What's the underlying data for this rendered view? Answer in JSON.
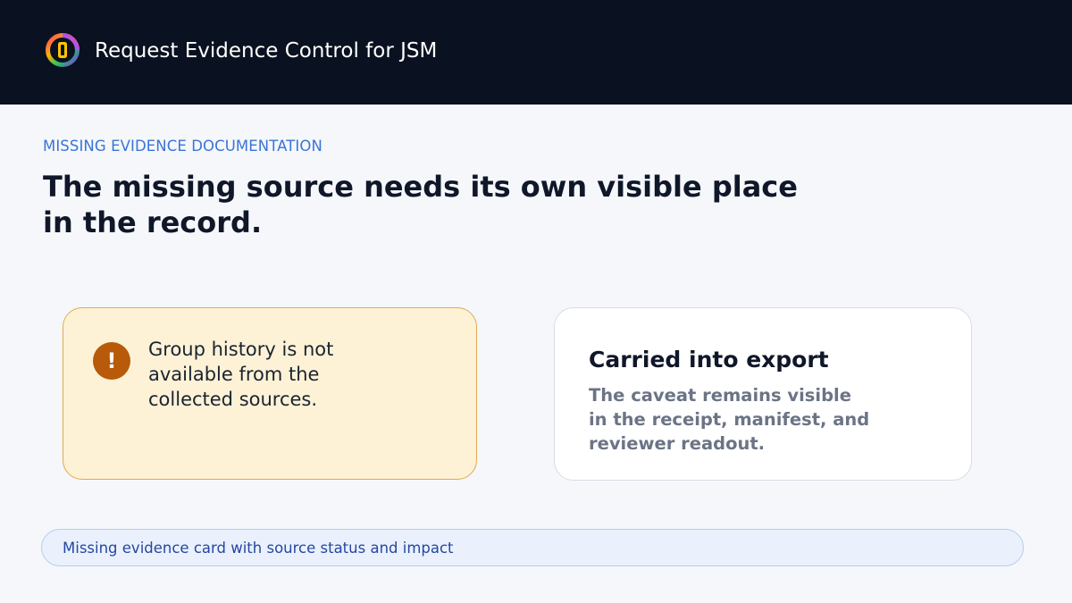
{
  "header": {
    "logo_icon": "ring-logo-icon",
    "title": "Request Evidence Control for JSM"
  },
  "main": {
    "eyebrow": "MISSING EVIDENCE DOCUMENTATION",
    "headline": "The missing source needs its own visible place in the record."
  },
  "missing_card": {
    "icon": "exclamation-icon",
    "icon_glyph": "!",
    "text": "Group history is not available from the collected sources."
  },
  "export_card": {
    "title": "Carried into export",
    "body": "The caveat remains visible in the receipt, manifest, and reviewer readout."
  },
  "caption": {
    "text": "Missing evidence card with source status and impact"
  },
  "colors": {
    "header_bg": "#0a1120",
    "accent_blue": "#3a74d8",
    "warning_bg": "#fdf2d6",
    "warning_border": "#e0aa4e",
    "warning_icon": "#b85a09",
    "caption_bg": "#eaf1fd",
    "caption_text": "#2647a0"
  }
}
